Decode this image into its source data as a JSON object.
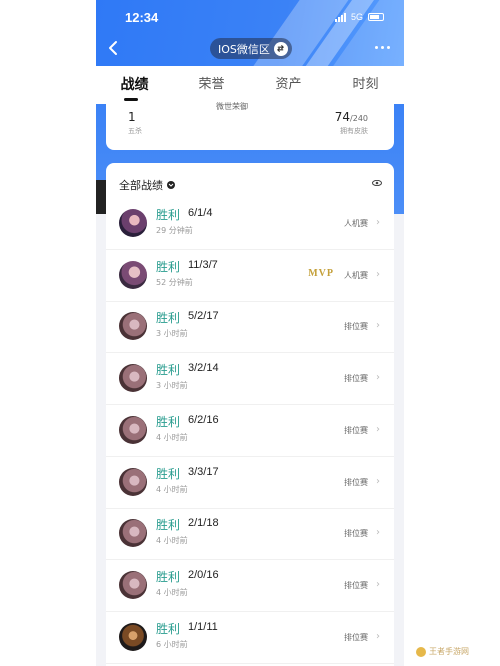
{
  "status_bar": {
    "time": "12:34",
    "network": "5G"
  },
  "header": {
    "server": "IOS微信区"
  },
  "tabs": [
    {
      "label": "战绩",
      "active": true
    },
    {
      "label": "荣誉",
      "active": false
    },
    {
      "label": "资产",
      "active": false
    },
    {
      "label": "时刻",
      "active": false
    }
  ],
  "summary": {
    "left_value": "1",
    "left_label": "五杀",
    "mid_label": "微世荣御",
    "right_value": "74",
    "right_total": "/240",
    "right_label": "拥有皮肤"
  },
  "records": {
    "title": "全部战绩",
    "rows": [
      {
        "result": "胜利",
        "kda": "6/1/4",
        "ago": "29 分钟前",
        "mode": "人机赛",
        "mvp": ""
      },
      {
        "result": "胜利",
        "kda": "11/3/7",
        "ago": "52 分钟前",
        "mode": "人机赛",
        "mvp": "MVP"
      },
      {
        "result": "胜利",
        "kda": "5/2/17",
        "ago": "3 小时前",
        "mode": "排位赛",
        "mvp": ""
      },
      {
        "result": "胜利",
        "kda": "3/2/14",
        "ago": "3 小时前",
        "mode": "排位赛",
        "mvp": ""
      },
      {
        "result": "胜利",
        "kda": "6/2/16",
        "ago": "4 小时前",
        "mode": "排位赛",
        "mvp": ""
      },
      {
        "result": "胜利",
        "kda": "3/3/17",
        "ago": "4 小时前",
        "mode": "排位赛",
        "mvp": ""
      },
      {
        "result": "胜利",
        "kda": "2/1/18",
        "ago": "4 小时前",
        "mode": "排位赛",
        "mvp": ""
      },
      {
        "result": "胜利",
        "kda": "2/0/16",
        "ago": "4 小时前",
        "mode": "排位赛",
        "mvp": ""
      },
      {
        "result": "胜利",
        "kda": "1/1/11",
        "ago": "6 小时前",
        "mode": "排位赛",
        "mvp": ""
      }
    ]
  },
  "watermark": {
    "text": "王者手游网"
  },
  "colors": {
    "accent_blue": "#3b82f6",
    "win_teal": "#2a9d8f",
    "mvp_gold": "#c4a03a"
  }
}
